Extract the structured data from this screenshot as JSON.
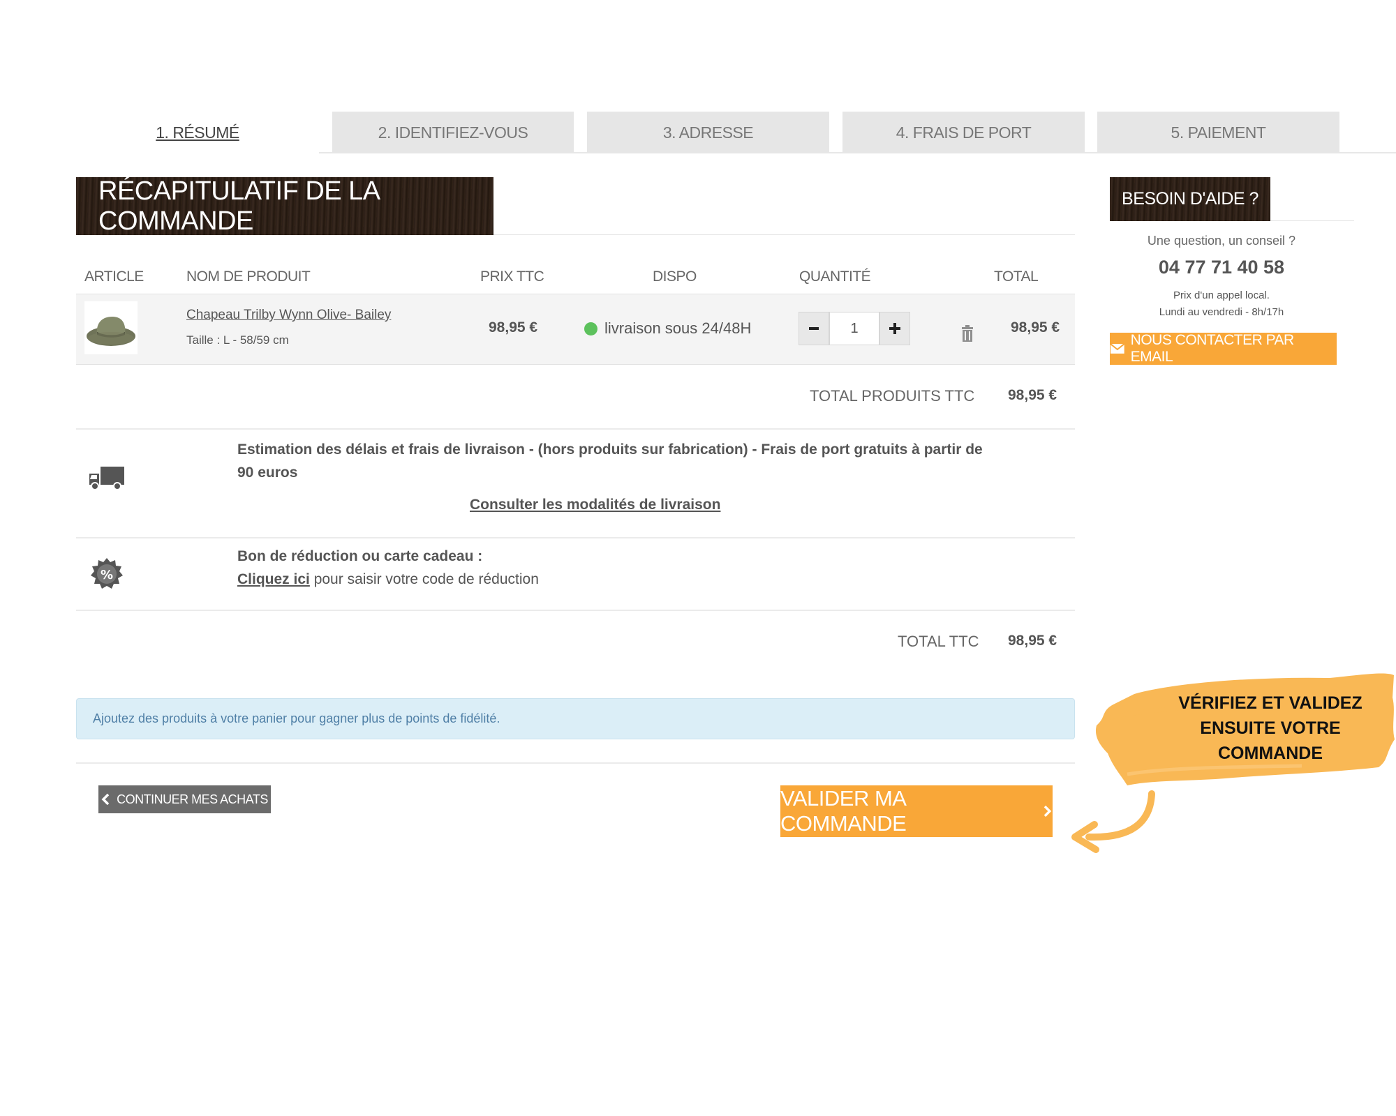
{
  "steps": [
    {
      "label": "1. RÉSUMÉ"
    },
    {
      "label": "2. IDENTIFIEZ-VOUS"
    },
    {
      "label": "3. ADRESSE"
    },
    {
      "label": "4. FRAIS DE PORT"
    },
    {
      "label": "5. PAIEMENT"
    }
  ],
  "summary": {
    "title": "RÉCAPITULATIF DE LA COMMANDE",
    "columns": {
      "article": "ARTICLE",
      "name": "NOM DE PRODUIT",
      "price": "PRIX TTC",
      "dispo": "DISPO",
      "qty": "QUANTITÉ",
      "total": "TOTAL"
    },
    "item": {
      "name": "Chapeau Trilby Wynn Olive- Bailey",
      "size": "Taille : L - 58/59 cm",
      "price": "98,95 €",
      "availability": "livraison sous 24/48H",
      "quantity": "1",
      "total": "98,95 €"
    },
    "products_total_label": "TOTAL PRODUITS TTC",
    "products_total": "98,95 €",
    "shipping_text": "Estimation des délais et frais de livraison - (hors produits sur fabrication) - Frais de port gratuits à partir de 90 euros",
    "shipping_link": "Consulter les modalités de livraison",
    "promo_title": "Bon de réduction ou carte cadeau :",
    "promo_link": "Cliquez ici",
    "promo_rest": "pour saisir votre code de réduction",
    "total_label": "TOTAL TTC",
    "total": "98,95 €",
    "loyalty_msg": "Ajoutez des produits à votre panier pour gagner plus de points de fidélité."
  },
  "buttons": {
    "continue": "CONTINUER MES ACHATS",
    "validate": "VALIDER MA COMMANDE"
  },
  "help": {
    "title": "BESOIN D'AIDE ?",
    "question": "Une question, un conseil ?",
    "phone": "04 77 71 40 58",
    "price_note": "Prix d'un appel local.",
    "hours": "Lundi au vendredi - 8h/17h",
    "email_button": "NOUS CONTACTER PAR EMAIL"
  },
  "annotation": {
    "line1": "VÉRIFIEZ ET VALIDEZ",
    "line2": "ENSUITE VOTRE",
    "line3": "COMMANDE"
  },
  "colors": {
    "accent": "#f9a738",
    "header_dark": "#2a1d16",
    "in_stock": "#5cc15c"
  },
  "icons": [
    "hat-thumbnail",
    "minus-icon",
    "plus-icon",
    "trash-icon",
    "truck-icon",
    "percent-badge-icon",
    "chevron-left-icon",
    "chevron-right-icon",
    "envelope-icon",
    "curved-arrow-icon"
  ]
}
